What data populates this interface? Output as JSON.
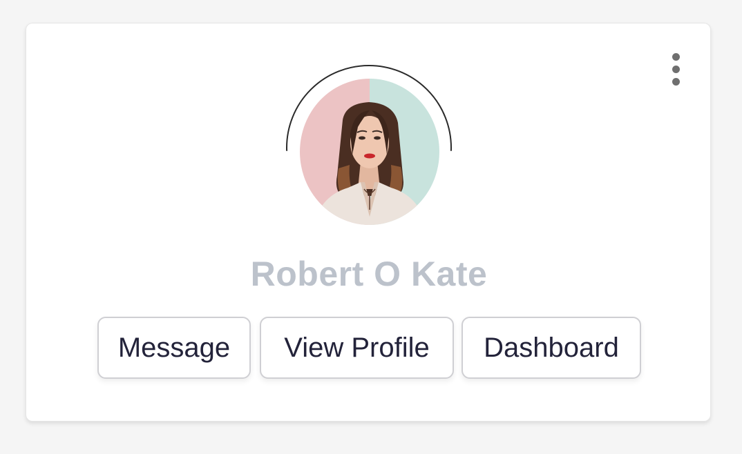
{
  "profile": {
    "name": "Robert O Kate"
  },
  "actions": {
    "message_label": "Message",
    "view_profile_label": "View Profile",
    "dashboard_label": "Dashboard"
  },
  "icons": {
    "menu": "more-vertical-icon"
  },
  "colors": {
    "background": "#f5f5f5",
    "card": "#ffffff",
    "name_text": "#bcc2cb",
    "button_text": "#23233a",
    "button_border": "#cfcfd3",
    "avatar_left_bg": "#ecc3c4",
    "avatar_right_bg": "#c8e3dd"
  }
}
